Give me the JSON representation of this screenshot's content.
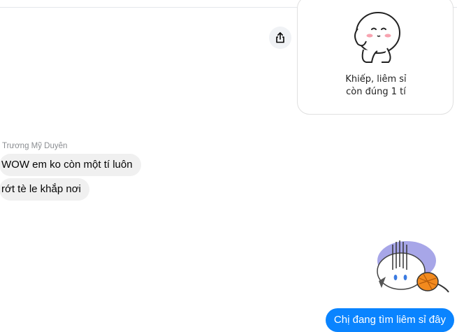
{
  "conversation": {
    "sticker_caption_line1": "Khiếp, liêm sỉ",
    "sticker_caption_line2": "còn đúng 1 tí",
    "incoming": {
      "sender": "Trương Mỹ Duyên",
      "messages": [
        "WOW em ko còn một tí luôn",
        "rớt tè le khắp nơi"
      ]
    },
    "outgoing_message": "Chị đang tìm liêm sỉ đây"
  },
  "icons": {
    "share": "share-icon",
    "sticker1": "shy-bunny-sticker",
    "sticker2": "fallen-cat-sticker"
  },
  "colors": {
    "outgoing_bubble": "#0a84ff",
    "incoming_bubble": "#f0f0f0",
    "sender_name": "#8a8d91"
  }
}
